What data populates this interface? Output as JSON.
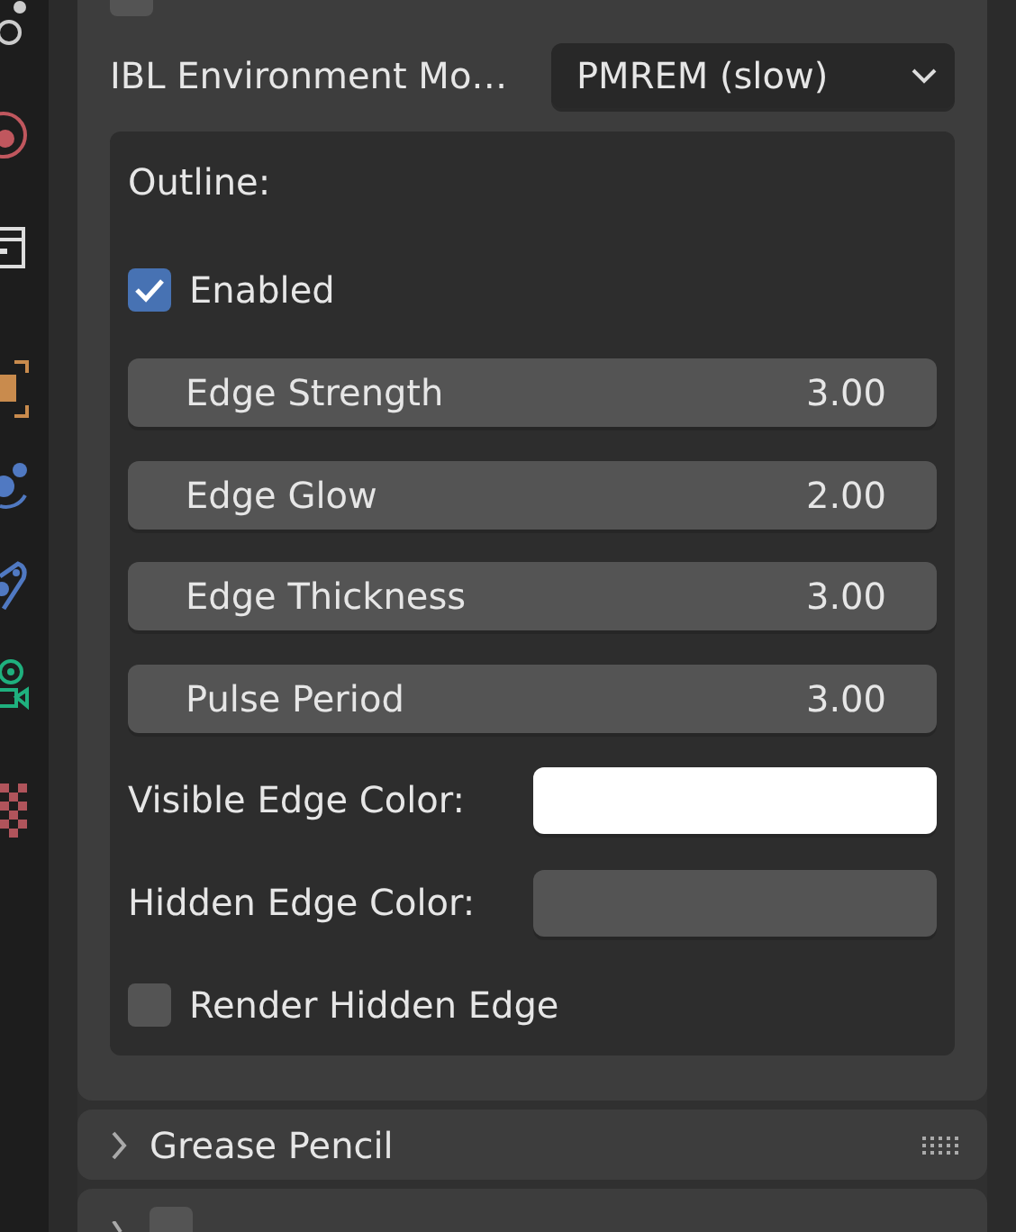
{
  "top_checkbox": {
    "checked": false
  },
  "ibl": {
    "label": "IBL Environment Mo…",
    "value": "PMREM (slow)"
  },
  "outline": {
    "title": "Outline:",
    "items": [
      {
        "kind": "checkbox",
        "label": "Enabled",
        "checked": true
      },
      {
        "kind": "number",
        "label": "Edge Strength",
        "value": "3.00"
      },
      {
        "kind": "number",
        "label": "Edge Glow",
        "value": "2.00"
      },
      {
        "kind": "number",
        "label": "Edge Thickness",
        "value": "3.00"
      },
      {
        "kind": "number",
        "label": "Pulse Period",
        "value": "3.00"
      },
      {
        "kind": "color",
        "label": "Visible Edge Color:",
        "color": "#ffffff"
      },
      {
        "kind": "color",
        "label": "Hidden Edge Color:",
        "color": "#545454"
      },
      {
        "kind": "checkbox",
        "label": "Render Hidden Edge",
        "checked": false
      }
    ]
  },
  "panels": [
    {
      "title": "Grease Pencil",
      "expanded": false
    }
  ],
  "bottom_panel": {
    "checkbox": {
      "checked": false
    }
  }
}
